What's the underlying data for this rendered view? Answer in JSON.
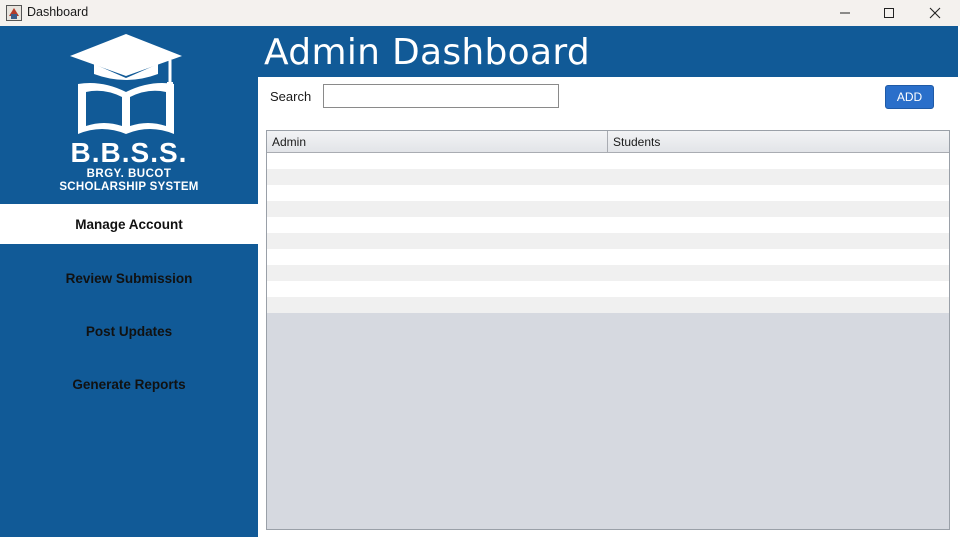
{
  "window": {
    "title": "Dashboard"
  },
  "sidebar": {
    "logo": {
      "main": "B.B.S.S.",
      "line1": "BRGY. BUCOT",
      "line2": "SCHOLARSHIP SYSTEM"
    },
    "items": [
      {
        "label": "Manage Account",
        "active": true
      },
      {
        "label": "Review Submission",
        "active": false
      },
      {
        "label": "Post Updates",
        "active": false
      },
      {
        "label": "Generate Reports",
        "active": false
      }
    ]
  },
  "header": {
    "title": "Admin Dashboard"
  },
  "search": {
    "label": "Search",
    "value": ""
  },
  "toolbar": {
    "add_label": "ADD"
  },
  "table": {
    "columns": [
      "Admin",
      "Students"
    ],
    "rows": []
  },
  "colors": {
    "brand_blue": "#115a97",
    "button_blue": "#2a6fca"
  }
}
